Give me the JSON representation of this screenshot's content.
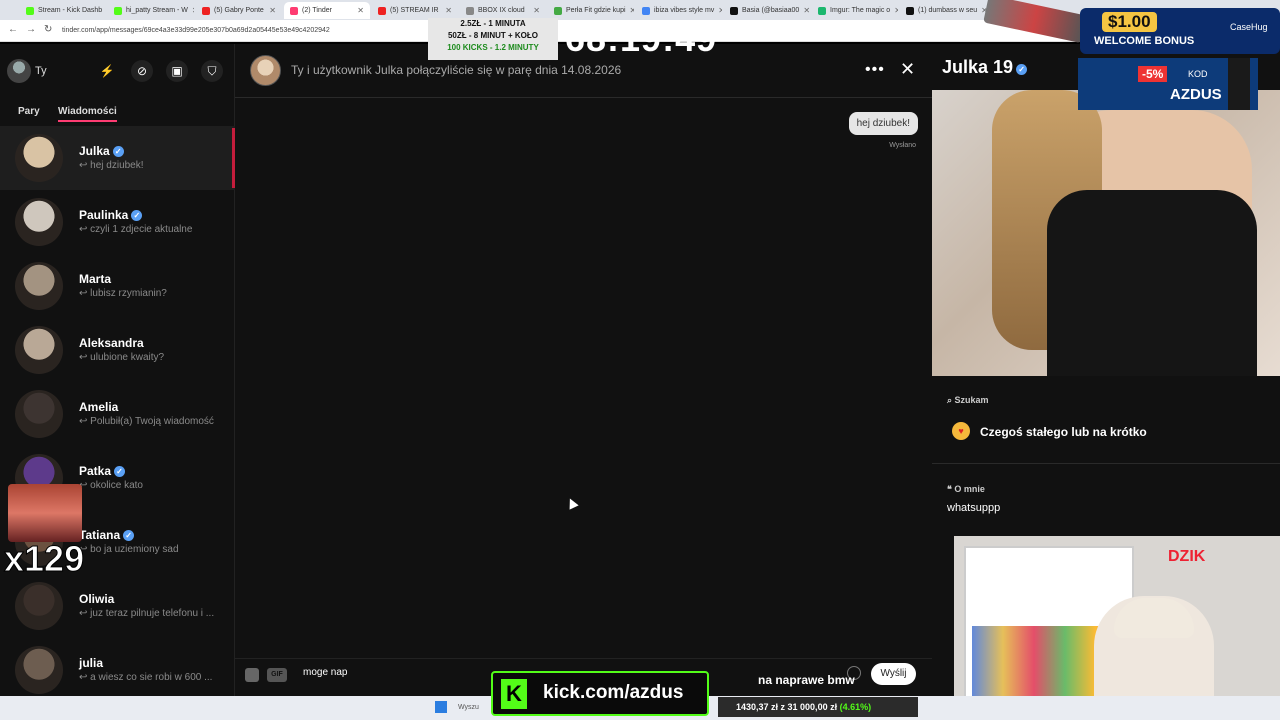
{
  "browser": {
    "tabs": [
      {
        "label": "Stream - Kick Dashb",
        "color": "#53fc18"
      },
      {
        "label": "hi_patty Stream - W",
        "color": "#53fc18"
      },
      {
        "label": "(5) Gabry Ponte",
        "color": "#e22"
      },
      {
        "label": "(2) Tinder",
        "color": "#fe3c72"
      },
      {
        "label": "(5) STREAM IR",
        "color": "#e22"
      },
      {
        "label": "BBOX IX cloud",
        "color": "#888"
      },
      {
        "label": "Perła Fit gdzie kupi",
        "color": "#4a4"
      },
      {
        "label": "ibiza vibes style mv",
        "color": "#4285f4"
      },
      {
        "label": "Basia (@basiaa00",
        "color": "#111"
      },
      {
        "label": "Imgur: The magic o",
        "color": "#1bb76e"
      },
      {
        "label": "(1) dumbass w seu",
        "color": "#111"
      }
    ],
    "url": "tinder.com/app/messages/69ce4a3e33d99e205e307b0a69d2a05445e53e49c4202942"
  },
  "sidebar": {
    "me_label": "Ty",
    "tabs": {
      "pairs": "Pary",
      "messages": "Wiadomości"
    },
    "conversations": [
      {
        "name": "Julka",
        "verified": true,
        "message": "↩ hej dziubek!",
        "color": "#d9c3a4"
      },
      {
        "name": "Paulinka",
        "verified": true,
        "message": "↩ czyli 1 zdjecie aktualne",
        "color": "#cfc7bd"
      },
      {
        "name": "Marta",
        "verified": false,
        "message": "↩ lubisz rzymianin?",
        "color": "#a39381"
      },
      {
        "name": "Aleksandra",
        "verified": false,
        "message": "↩ ulubione kwaity?",
        "color": "#b9a896"
      },
      {
        "name": "Amelia",
        "verified": false,
        "message": "↩ Polubił(a) Twoją wiadomość",
        "color": "#3d3431"
      },
      {
        "name": "Patka",
        "verified": true,
        "message": "↩ okolice kato",
        "color": "#5d3a8b"
      },
      {
        "name": "Tatiana",
        "verified": true,
        "message": "↩ bo ja uziemiony sad",
        "color": "#6b5140"
      },
      {
        "name": "Oliwia",
        "verified": false,
        "message": "↩ juz teraz pilnuje telefonu i ...",
        "color": "#3a2f2a"
      },
      {
        "name": "julia",
        "verified": false,
        "message": "↩ a wiesz co sie robi w 600 ...",
        "color": "#6d5d50"
      }
    ]
  },
  "chat": {
    "match_text": "Ty i użytkownik Julka połączyliście się w parę dnia 14.08.2026",
    "bubble": "hej dziubek!",
    "status": "Wysłano",
    "gif": "GIF",
    "input_value": "moge nap",
    "send": "Wyślij"
  },
  "profile": {
    "name": "Julka 19",
    "looking_label": "Szukam",
    "looking_value": "Czegoś stałego lub na krótko",
    "about_label": "O mnie",
    "about_value": "whatsuppp"
  },
  "overlays": {
    "timer": "68:19:49",
    "promo_lines": [
      "2.5ZŁ - 1 MINUTA",
      "50ZŁ - 8 MINUT + KOŁO",
      "100 KICKS - 1.2 MINUTY"
    ],
    "bonus_amount": "$1.00",
    "bonus_text": "WELCOME BONUS",
    "bonus_brand": "CaseHug",
    "discount": "-5%",
    "kod_label": "KOD",
    "kod_code": "AZDUS",
    "kick_letter": "K",
    "kick_url": "kick.com/azdus",
    "bmw_text": "na naprawe bmw",
    "multiplier": "x129",
    "taskbar_search": "Wyszu",
    "ticker": "1430,37 zł z 31 000,00 zł",
    "ticker_pct": "(4.61%)",
    "dzik": "DZIK"
  }
}
